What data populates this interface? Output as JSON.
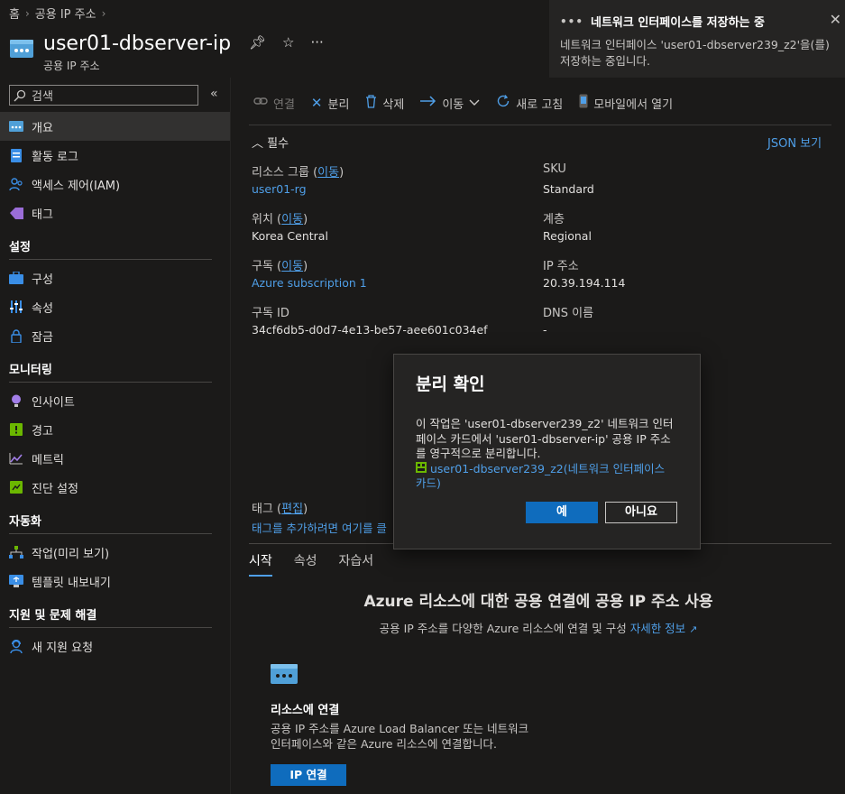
{
  "breadcrumb": {
    "home": "홈",
    "parent": "공용 IP 주소"
  },
  "resource": {
    "title": "user01-dbserver-ip",
    "subtitle": "공용 IP 주소"
  },
  "notification": {
    "title": "네트워크 인터페이스를 저장하는 중",
    "body": "네트워크 인터페이스 'user01-dbserver239_z2'을(를) 저장하는 중입니다."
  },
  "sidebar": {
    "search_placeholder": "검색",
    "items_top": [
      {
        "label": "개요",
        "icon": "overview-icon"
      },
      {
        "label": "활동 로그",
        "icon": "activity-log-icon"
      },
      {
        "label": "액세스 제어(IAM)",
        "icon": "iam-icon"
      },
      {
        "label": "태그",
        "icon": "tag-icon"
      }
    ],
    "sections": [
      {
        "title": "설정",
        "items": [
          "구성",
          "속성",
          "잠금"
        ]
      },
      {
        "title": "모니터링",
        "items": [
          "인사이트",
          "경고",
          "메트릭",
          "진단 설정"
        ]
      },
      {
        "title": "자동화",
        "items": [
          "작업(미리 보기)",
          "템플릿 내보내기"
        ]
      },
      {
        "title": "지원 및 문제 해결",
        "items": [
          "새 지원 요청"
        ]
      }
    ]
  },
  "toolbar": {
    "connect": "연결",
    "dissociate": "분리",
    "delete": "삭제",
    "move": "이동",
    "refresh": "새로 고침",
    "mobile": "모바일에서 열기"
  },
  "essentials": {
    "header": "필수",
    "json_view": "JSON 보기",
    "move_link": "이동",
    "left": [
      {
        "label": "리소스 그룹",
        "value": "user01-rg",
        "is_link": true
      },
      {
        "label": "위치",
        "value": "Korea Central",
        "is_link": false
      },
      {
        "label": "구독",
        "value": "Azure subscription 1",
        "is_link": true
      },
      {
        "label": "구독 ID",
        "value": "34cf6db5-d0d7-4e13-be57-aee601c034ef",
        "is_link": false
      }
    ],
    "right": [
      {
        "label": "SKU",
        "value": "Standard"
      },
      {
        "label": "계층",
        "value": "Regional"
      },
      {
        "label": "IP 주소",
        "value": "20.39.194.114"
      },
      {
        "label": "DNS 이름",
        "value": "-"
      }
    ],
    "tags_label": "태그",
    "tags_edit": "편집",
    "tags_add": "태그를 추가하려면 여기를 클"
  },
  "tabs": [
    "시작",
    "속성",
    "자습서"
  ],
  "getting_started": {
    "title": "Azure 리소스에 대한 공용 연결에 공용 IP 주소 사용",
    "subtitle": "공용 IP 주소를 다양한 Azure 리소스에 연결 및 구성",
    "learn_more": "자세한 정보",
    "card_title": "리소스에 연결",
    "card_desc": "공용 IP 주소를 Azure Load Balancer 또는 네트워크 인터페이스와 같은 Azure 리소스에 연결합니다.",
    "card_button": "IP 연결"
  },
  "dialog": {
    "title": "분리 확인",
    "body": "이 작업은 'user01-dbserver239_z2' 네트워크 인터페이스 카드에서 'user01-dbserver-ip' 공용 IP 주소를 영구적으로 분리합니다.",
    "link": "user01-dbserver239_z2(네트워크 인터페이스 카드)",
    "yes": "예",
    "no": "아니요"
  }
}
